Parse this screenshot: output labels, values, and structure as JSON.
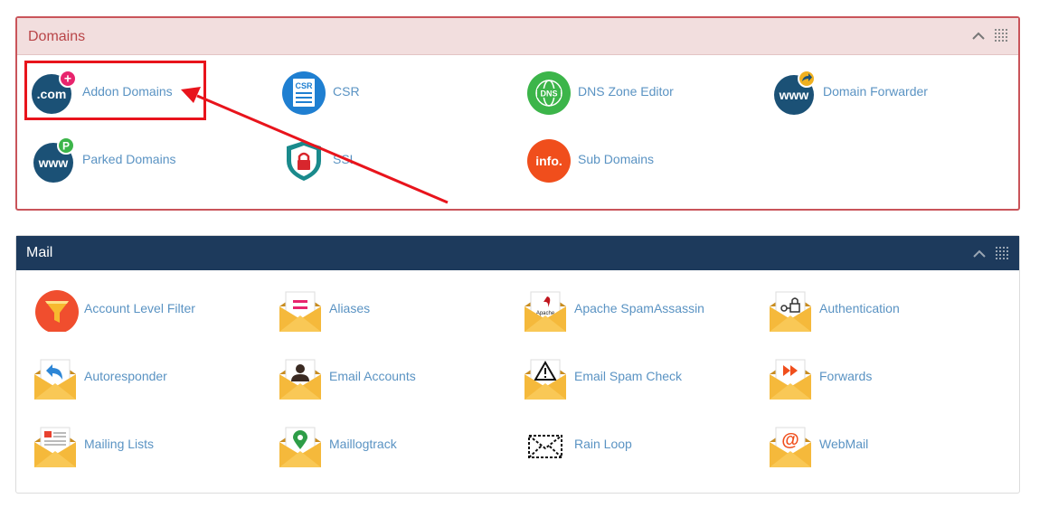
{
  "domains": {
    "title": "Domains",
    "items": [
      {
        "label": "Addon Domains",
        "icon": "addon-domains-icon"
      },
      {
        "label": "CSR",
        "icon": "csr-icon"
      },
      {
        "label": "DNS Zone Editor",
        "icon": "dns-zone-editor-icon"
      },
      {
        "label": "Domain Forwarder",
        "icon": "domain-forwarder-icon"
      },
      {
        "label": "Parked Domains",
        "icon": "parked-domains-icon"
      },
      {
        "label": "SSL",
        "icon": "ssl-icon"
      },
      {
        "label": "Sub Domains",
        "icon": "sub-domains-icon"
      }
    ],
    "icon_text": {
      "com": ".com",
      "csr": "CSR",
      "dns": "DNS",
      "www": "www",
      "park": "P",
      "info": "info.",
      "plus": "+"
    }
  },
  "mail": {
    "title": "Mail",
    "items": [
      {
        "label": "Account Level Filter",
        "icon": "filter-funnel-icon"
      },
      {
        "label": "Aliases",
        "icon": "aliases-envelope-icon"
      },
      {
        "label": "Apache SpamAssassin",
        "icon": "spamassassin-envelope-icon"
      },
      {
        "label": "Authentication",
        "icon": "authentication-envelope-icon"
      },
      {
        "label": "Autoresponder",
        "icon": "autoresponder-envelope-icon"
      },
      {
        "label": "Email Accounts",
        "icon": "email-accounts-envelope-icon"
      },
      {
        "label": "Email Spam Check",
        "icon": "spam-check-envelope-icon"
      },
      {
        "label": "Forwards",
        "icon": "forwards-envelope-icon"
      },
      {
        "label": "Mailing Lists",
        "icon": "mailing-lists-envelope-icon"
      },
      {
        "label": "Maillogtrack",
        "icon": "maillogtrack-envelope-icon"
      },
      {
        "label": "Rain Loop",
        "icon": "rainloop-envelope-icon"
      },
      {
        "label": "WebMail",
        "icon": "webmail-envelope-icon"
      }
    ],
    "icon_text": {
      "apache": "Apache",
      "at": "@"
    }
  },
  "colors": {
    "domains_header_bg": "#f2dede",
    "domains_title": "#b94548",
    "mail_header_bg": "#1d3a5c",
    "link": "#5a93c3",
    "annotation": "#e8141c"
  }
}
